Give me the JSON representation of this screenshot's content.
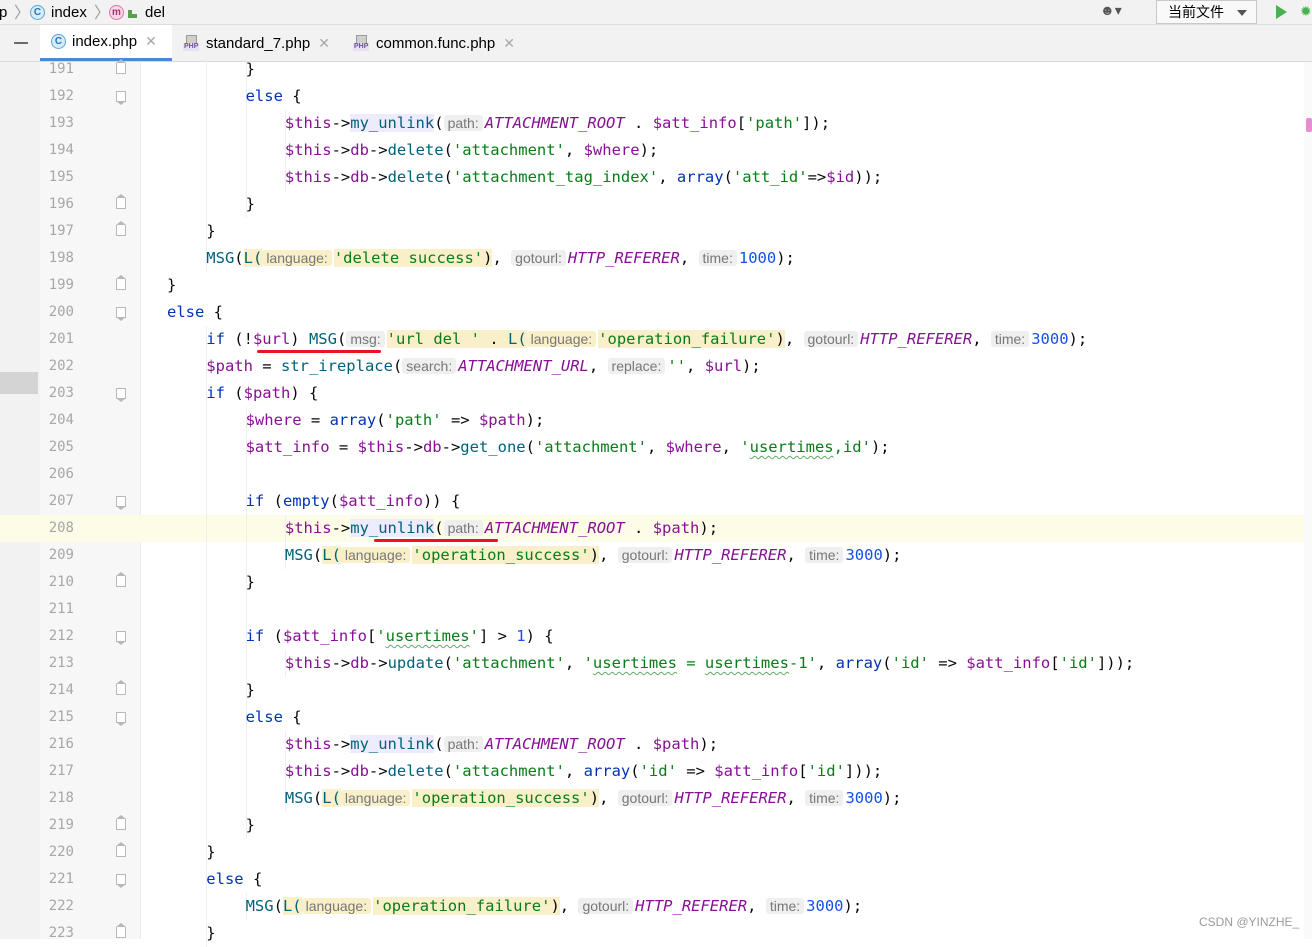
{
  "nav": {
    "crumbs": [
      "p",
      "index",
      "del"
    ],
    "run_config": "当前文件"
  },
  "tabs": [
    {
      "label": "index.php",
      "active": true,
      "icon": "c-class-icon"
    },
    {
      "label": "standard_7.php",
      "active": false,
      "icon": "php-file-icon"
    },
    {
      "label": "common.func.php",
      "active": false,
      "icon": "php-file-icon"
    }
  ],
  "editor": {
    "current_line": "208",
    "lines": [
      {
        "n": "191",
        "indent": 3,
        "code": [
          [
            "p",
            "}"
          ]
        ]
      },
      {
        "n": "192",
        "indent": 3,
        "code": [
          [
            "kw",
            "else"
          ],
          [
            "p",
            " {"
          ]
        ]
      },
      {
        "n": "193",
        "indent": 4,
        "code": [
          [
            "var",
            "$this"
          ],
          [
            "p",
            "->"
          ],
          [
            "my",
            "my_unlink"
          ],
          [
            "p",
            "("
          ],
          [
            "hint",
            "path:"
          ],
          [
            "const",
            "ATTACHMENT_ROOT"
          ],
          [
            "p",
            " . "
          ],
          [
            "var",
            "$att_info"
          ],
          [
            "p",
            "["
          ],
          [
            "str",
            "'path'"
          ],
          [
            "p",
            "]);"
          ]
        ]
      },
      {
        "n": "194",
        "indent": 4,
        "code": [
          [
            "var",
            "$this"
          ],
          [
            "p",
            "->"
          ],
          [
            "var",
            "db"
          ],
          [
            "p",
            "->"
          ],
          [
            "mth",
            "delete"
          ],
          [
            "p",
            "("
          ],
          [
            "str",
            "'attachment'"
          ],
          [
            "p",
            ", "
          ],
          [
            "var",
            "$where"
          ],
          [
            "p",
            ");"
          ]
        ]
      },
      {
        "n": "195",
        "indent": 4,
        "code": [
          [
            "var",
            "$this"
          ],
          [
            "p",
            "->"
          ],
          [
            "var",
            "db"
          ],
          [
            "p",
            "->"
          ],
          [
            "mth",
            "delete"
          ],
          [
            "p",
            "("
          ],
          [
            "str",
            "'attachment_tag_index'"
          ],
          [
            "p",
            ", "
          ],
          [
            "kw",
            "array"
          ],
          [
            "p",
            "("
          ],
          [
            "str",
            "'att_id'"
          ],
          [
            "p",
            "=>"
          ],
          [
            "var",
            "$id"
          ],
          [
            "p",
            "));"
          ]
        ]
      },
      {
        "n": "196",
        "indent": 3,
        "code": [
          [
            "p",
            "}"
          ]
        ]
      },
      {
        "n": "197",
        "indent": 2,
        "code": [
          [
            "p",
            "}"
          ]
        ]
      },
      {
        "n": "198",
        "indent": 2,
        "code": [
          [
            "call",
            "MSG"
          ],
          [
            "p",
            "("
          ],
          [
            "hlcall",
            "L("
          ],
          [
            "hlhint",
            "language:"
          ],
          [
            "hlstr",
            "'delete success'"
          ],
          [
            "hlp",
            ")"
          ],
          [
            "p",
            ", "
          ],
          [
            "hint",
            "gotourl:"
          ],
          [
            "const",
            "HTTP_REFERER"
          ],
          [
            "p",
            ", "
          ],
          [
            "hint",
            "time:"
          ],
          [
            "num",
            "1000"
          ],
          [
            "p",
            ");"
          ]
        ]
      },
      {
        "n": "199",
        "indent": 1,
        "code": [
          [
            "p",
            "}"
          ]
        ]
      },
      {
        "n": "200",
        "indent": 1,
        "code": [
          [
            "kw",
            "else"
          ],
          [
            "p",
            " {"
          ]
        ]
      },
      {
        "n": "201",
        "indent": 2,
        "code": [
          [
            "kw",
            "if"
          ],
          [
            "p",
            " (!"
          ],
          [
            "var",
            "$url"
          ],
          [
            "p",
            ") "
          ],
          [
            "call",
            "MSG"
          ],
          [
            "p",
            "("
          ],
          [
            "hint",
            "msg:"
          ],
          [
            "hlstr",
            "'url del '"
          ],
          [
            "hlp",
            " . "
          ],
          [
            "hlcall",
            "L("
          ],
          [
            "hlhint",
            "language:"
          ],
          [
            "hlstr",
            "'operation_failure'"
          ],
          [
            "hlp",
            ")"
          ],
          [
            "p",
            ", "
          ],
          [
            "hint",
            "gotourl:"
          ],
          [
            "const",
            "HTTP_REFERER"
          ],
          [
            "p",
            ", "
          ],
          [
            "hint",
            "time:"
          ],
          [
            "num",
            "3000"
          ],
          [
            "p",
            ");"
          ]
        ]
      },
      {
        "n": "202",
        "indent": 2,
        "code": [
          [
            "var",
            "$path"
          ],
          [
            "p",
            " = "
          ],
          [
            "fn",
            "str_ireplace"
          ],
          [
            "p",
            "("
          ],
          [
            "hint",
            "search:"
          ],
          [
            "const",
            "ATTACHMENT_URL"
          ],
          [
            "p",
            ", "
          ],
          [
            "hint",
            "replace:"
          ],
          [
            "str",
            "''"
          ],
          [
            "p",
            ", "
          ],
          [
            "var",
            "$url"
          ],
          [
            "p",
            ");"
          ]
        ]
      },
      {
        "n": "203",
        "indent": 2,
        "code": [
          [
            "kw",
            "if"
          ],
          [
            "p",
            " ("
          ],
          [
            "var",
            "$path"
          ],
          [
            "p",
            ") {"
          ]
        ]
      },
      {
        "n": "204",
        "indent": 3,
        "code": [
          [
            "var",
            "$where"
          ],
          [
            "p",
            " = "
          ],
          [
            "kw",
            "array"
          ],
          [
            "p",
            "("
          ],
          [
            "str",
            "'path'"
          ],
          [
            "p",
            " => "
          ],
          [
            "var",
            "$path"
          ],
          [
            "p",
            ");"
          ]
        ]
      },
      {
        "n": "205",
        "indent": 3,
        "code": [
          [
            "var",
            "$att_info"
          ],
          [
            "p",
            " = "
          ],
          [
            "var",
            "$this"
          ],
          [
            "p",
            "->"
          ],
          [
            "var",
            "db"
          ],
          [
            "p",
            "->"
          ],
          [
            "mth",
            "get_one"
          ],
          [
            "p",
            "("
          ],
          [
            "str",
            "'attachment'"
          ],
          [
            "p",
            ", "
          ],
          [
            "var",
            "$where"
          ],
          [
            "p",
            ", "
          ],
          [
            "str",
            "'"
          ],
          [
            "wstr",
            "usertimes"
          ],
          [
            "str",
            ",id'"
          ],
          [
            "p",
            ");"
          ]
        ]
      },
      {
        "n": "206",
        "indent": 3,
        "code": []
      },
      {
        "n": "207",
        "indent": 3,
        "code": [
          [
            "kw",
            "if"
          ],
          [
            "p",
            " ("
          ],
          [
            "kw",
            "empty"
          ],
          [
            "p",
            "("
          ],
          [
            "var",
            "$att_info"
          ],
          [
            "p",
            ")) {"
          ]
        ]
      },
      {
        "n": "208",
        "indent": 4,
        "code": [
          [
            "var",
            "$this"
          ],
          [
            "p",
            "->"
          ],
          [
            "my",
            "my_unlink"
          ],
          [
            "p",
            "("
          ],
          [
            "hint",
            "path:"
          ],
          [
            "const",
            "ATTACHMENT_ROOT"
          ],
          [
            "p",
            " . "
          ],
          [
            "var",
            "$path"
          ],
          [
            "p",
            ");"
          ]
        ]
      },
      {
        "n": "209",
        "indent": 4,
        "code": [
          [
            "call",
            "MSG"
          ],
          [
            "p",
            "("
          ],
          [
            "hlcall",
            "L("
          ],
          [
            "hlhint",
            "language:"
          ],
          [
            "hlstr",
            "'operation_success'"
          ],
          [
            "hlp",
            ")"
          ],
          [
            "p",
            ", "
          ],
          [
            "hint",
            "gotourl:"
          ],
          [
            "const",
            "HTTP_REFERER"
          ],
          [
            "p",
            ", "
          ],
          [
            "hint",
            "time:"
          ],
          [
            "num",
            "3000"
          ],
          [
            "p",
            ");"
          ]
        ]
      },
      {
        "n": "210",
        "indent": 3,
        "code": [
          [
            "p",
            "}"
          ]
        ]
      },
      {
        "n": "211",
        "indent": 3,
        "code": []
      },
      {
        "n": "212",
        "indent": 3,
        "code": [
          [
            "kw",
            "if"
          ],
          [
            "p",
            " ("
          ],
          [
            "var",
            "$att_info"
          ],
          [
            "p",
            "["
          ],
          [
            "str",
            "'"
          ],
          [
            "wstr",
            "usertimes"
          ],
          [
            "str",
            "'"
          ],
          [
            "p",
            "] > "
          ],
          [
            "num",
            "1"
          ],
          [
            "p",
            ") {"
          ]
        ]
      },
      {
        "n": "213",
        "indent": 4,
        "code": [
          [
            "var",
            "$this"
          ],
          [
            "p",
            "->"
          ],
          [
            "var",
            "db"
          ],
          [
            "p",
            "->"
          ],
          [
            "mth",
            "update"
          ],
          [
            "p",
            "("
          ],
          [
            "str",
            "'attachment'"
          ],
          [
            "p",
            ", "
          ],
          [
            "str",
            "'"
          ],
          [
            "wstr",
            "usertimes"
          ],
          [
            "str",
            " = "
          ],
          [
            "wstr",
            "usertimes"
          ],
          [
            "str",
            "-1'"
          ],
          [
            "p",
            ", "
          ],
          [
            "kw",
            "array"
          ],
          [
            "p",
            "("
          ],
          [
            "str",
            "'id'"
          ],
          [
            "p",
            " => "
          ],
          [
            "var",
            "$att_info"
          ],
          [
            "p",
            "["
          ],
          [
            "str",
            "'id'"
          ],
          [
            "p",
            "]));"
          ]
        ]
      },
      {
        "n": "214",
        "indent": 3,
        "code": [
          [
            "p",
            "}"
          ]
        ]
      },
      {
        "n": "215",
        "indent": 3,
        "code": [
          [
            "kw",
            "else"
          ],
          [
            "p",
            " {"
          ]
        ]
      },
      {
        "n": "216",
        "indent": 4,
        "code": [
          [
            "var",
            "$this"
          ],
          [
            "p",
            "->"
          ],
          [
            "my",
            "my_unlink"
          ],
          [
            "p",
            "("
          ],
          [
            "hint",
            "path:"
          ],
          [
            "const",
            "ATTACHMENT_ROOT"
          ],
          [
            "p",
            " . "
          ],
          [
            "var",
            "$path"
          ],
          [
            "p",
            ");"
          ]
        ]
      },
      {
        "n": "217",
        "indent": 4,
        "code": [
          [
            "var",
            "$this"
          ],
          [
            "p",
            "->"
          ],
          [
            "var",
            "db"
          ],
          [
            "p",
            "->"
          ],
          [
            "mth",
            "delete"
          ],
          [
            "p",
            "("
          ],
          [
            "str",
            "'attachment'"
          ],
          [
            "p",
            ", "
          ],
          [
            "kw",
            "array"
          ],
          [
            "p",
            "("
          ],
          [
            "str",
            "'id'"
          ],
          [
            "p",
            " => "
          ],
          [
            "var",
            "$att_info"
          ],
          [
            "p",
            "["
          ],
          [
            "str",
            "'id'"
          ],
          [
            "p",
            "]));"
          ]
        ]
      },
      {
        "n": "218",
        "indent": 4,
        "code": [
          [
            "call",
            "MSG"
          ],
          [
            "p",
            "("
          ],
          [
            "hlcall",
            "L("
          ],
          [
            "hlhint",
            "language:"
          ],
          [
            "hlstr",
            "'operation_success'"
          ],
          [
            "hlp",
            ")"
          ],
          [
            "p",
            ", "
          ],
          [
            "hint",
            "gotourl:"
          ],
          [
            "const",
            "HTTP_REFERER"
          ],
          [
            "p",
            ", "
          ],
          [
            "hint",
            "time:"
          ],
          [
            "num",
            "3000"
          ],
          [
            "p",
            ");"
          ]
        ]
      },
      {
        "n": "219",
        "indent": 3,
        "code": [
          [
            "p",
            "}"
          ]
        ]
      },
      {
        "n": "220",
        "indent": 2,
        "code": [
          [
            "p",
            "}"
          ]
        ]
      },
      {
        "n": "221",
        "indent": 2,
        "code": [
          [
            "kw",
            "else"
          ],
          [
            "p",
            " {"
          ]
        ]
      },
      {
        "n": "222",
        "indent": 3,
        "code": [
          [
            "call",
            "MSG"
          ],
          [
            "p",
            "("
          ],
          [
            "hlcall",
            "L("
          ],
          [
            "hlhint",
            "language:"
          ],
          [
            "hlstr",
            "'operation_failure'"
          ],
          [
            "hlp",
            ")"
          ],
          [
            "p",
            ", "
          ],
          [
            "hint",
            "gotourl:"
          ],
          [
            "const",
            "HTTP_REFERER"
          ],
          [
            "p",
            ", "
          ],
          [
            "hint",
            "time:"
          ],
          [
            "num",
            "3000"
          ],
          [
            "p",
            ");"
          ]
        ]
      },
      {
        "n": "223",
        "indent": 2,
        "code": [
          [
            "p",
            "}"
          ]
        ]
      }
    ]
  },
  "watermark": "CSDN @YINZHE_"
}
